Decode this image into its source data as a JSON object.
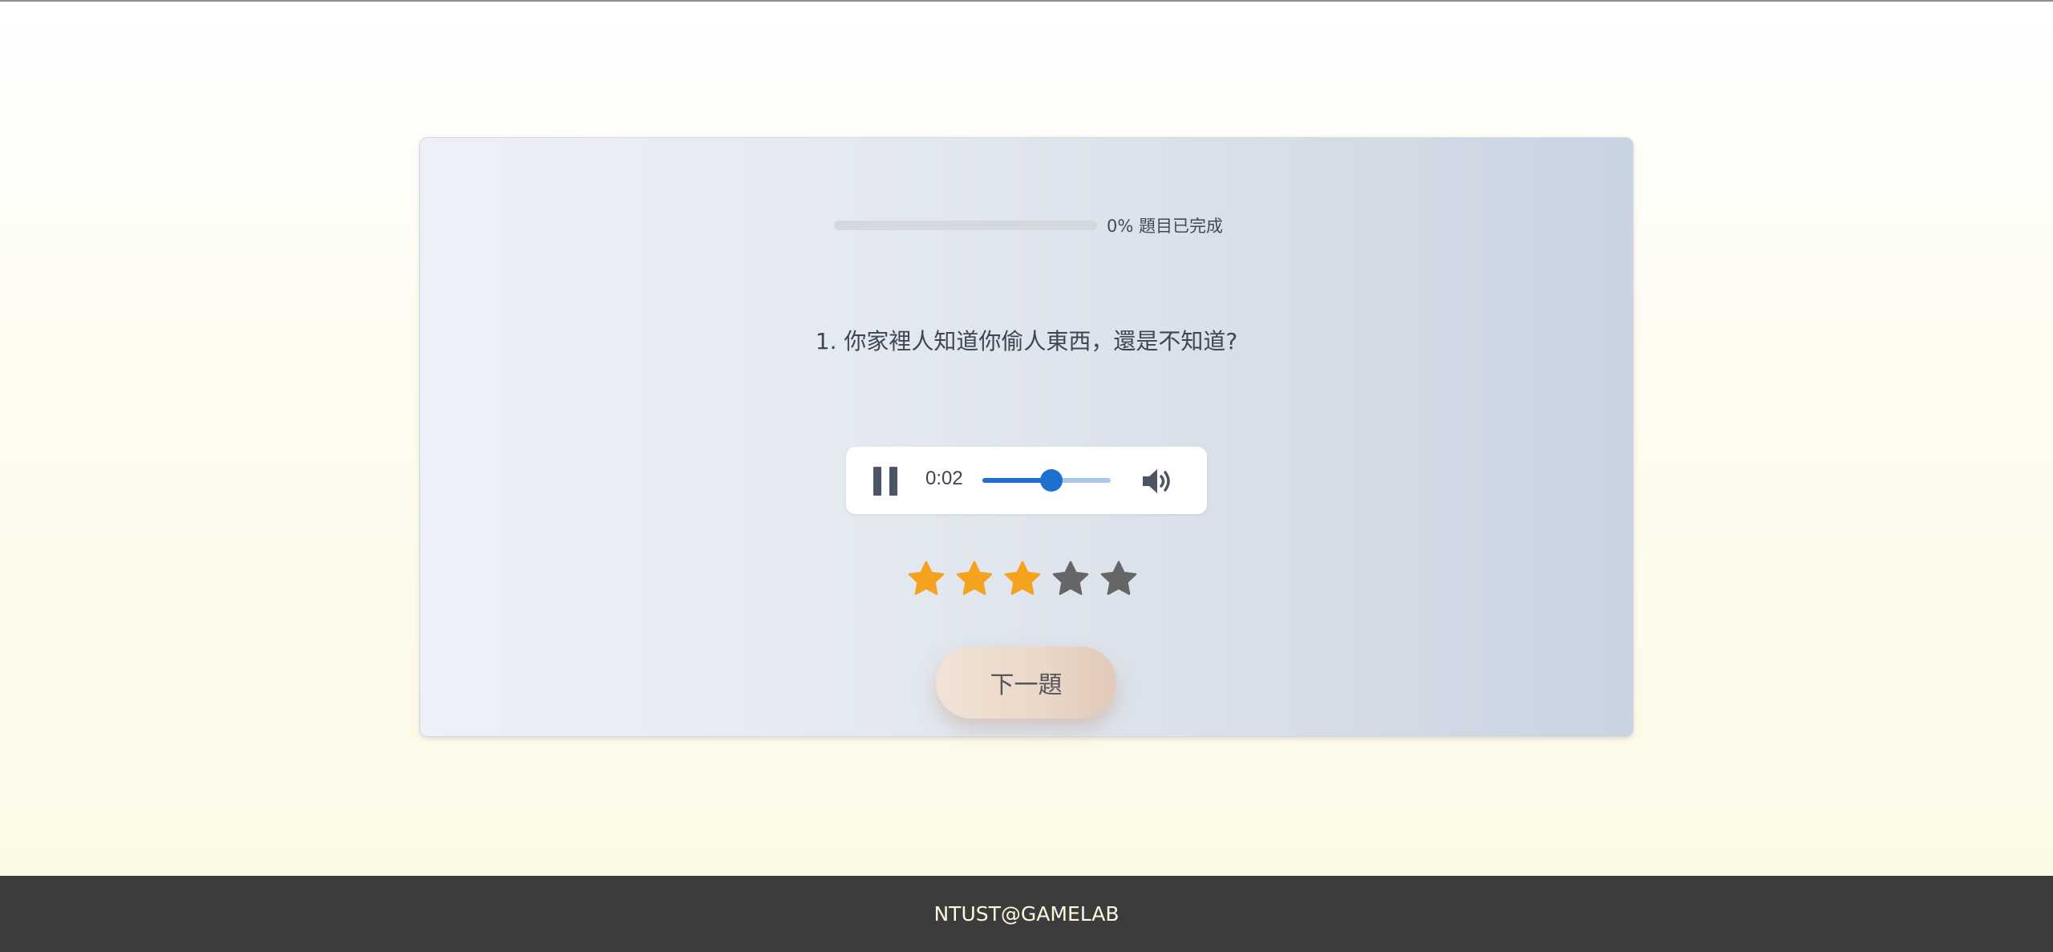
{
  "progress": {
    "value": 0,
    "label": "0% 題目已完成"
  },
  "question": {
    "text": "1. 你家裡人知道你偷人東西，還是不知道?"
  },
  "audio_player": {
    "state": "playing",
    "time": "0:02",
    "seek_fraction": 0.54,
    "play_pause_icon": "pause-icon",
    "volume_icon": "volume-icon"
  },
  "rating": {
    "value": 3,
    "max": 5,
    "active_color": "#f5a31f",
    "inactive_color": "#666666"
  },
  "next_button": {
    "label": "下一題"
  },
  "footer": {
    "text": "NTUST@GAMELAB"
  },
  "colors": {
    "accent": "#1f6fcf",
    "footer_bg": "#3c3c3c"
  }
}
